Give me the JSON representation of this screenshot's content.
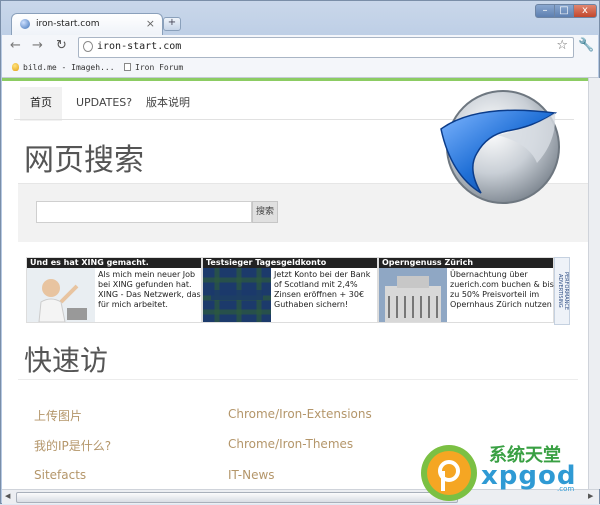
{
  "browser": {
    "tab_title": "iron-start.com",
    "tab_close": "×",
    "new_tab": "+",
    "url": "iron-start.com",
    "window_controls": {
      "minimize": "–",
      "maximize": "□",
      "close": "x"
    },
    "bookmarks": [
      {
        "label": "bild.me - Imageh...",
        "icon": "bulb-icon"
      },
      {
        "label": "Iron Forum",
        "icon": "page-icon"
      }
    ]
  },
  "page": {
    "tabs": [
      {
        "label": "首页",
        "active": true
      },
      {
        "label": "UPDATES?",
        "active": false
      },
      {
        "label": "版本说明",
        "active": false
      }
    ],
    "search_heading": "网页搜索",
    "search_button": "搜索",
    "search_value": "",
    "ads": [
      {
        "title": "Und es hat XING gemacht.",
        "text": "Als mich mein neuer Job bei XING gefunden hat. XING - Das Netzwerk, das für mich arbeitet."
      },
      {
        "title": "Testsieger Tagesgeldkonto",
        "text": "Jetzt Konto bei der Bank of Scotland mit 2,4% Zinsen eröffnen + 30€ Guthaben sichern!"
      },
      {
        "title": "Operngenuss Zürich",
        "text": "Übernachtung über zuerich.com buchen & bis zu 50% Preisvorteil im Opernhaus Zürich nutzen"
      }
    ],
    "ad_network_label": "PERFORMANCE ADVERTISING",
    "quick_heading": "快速访",
    "quick_links": [
      {
        "label": "上传图片"
      },
      {
        "label": "Chrome/Iron-Extensions"
      },
      {
        "label": "我的IP是什么?"
      },
      {
        "label": "Chrome/Iron-Themes"
      },
      {
        "label": "Sitefacts"
      },
      {
        "label": "IT-News"
      }
    ]
  },
  "watermark": {
    "title": "系统天堂",
    "site": "xpgod",
    "domain": ".com"
  },
  "colors": {
    "accent_green": "#8ccc63",
    "link": "#b4966a",
    "logo_blue": "#1f6fd6"
  }
}
